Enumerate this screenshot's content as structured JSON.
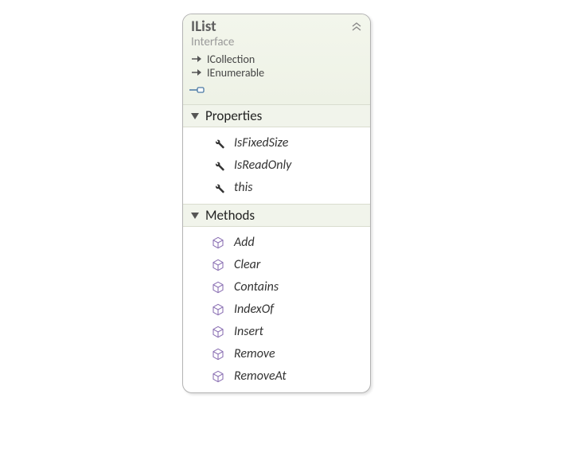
{
  "header": {
    "title": "IList",
    "subtitle": "Interface",
    "inherits": [
      "ICollection",
      "IEnumerable"
    ]
  },
  "sections": {
    "properties": {
      "label": "Properties",
      "members": [
        "IsFixedSize",
        "IsReadOnly",
        "this"
      ]
    },
    "methods": {
      "label": "Methods",
      "members": [
        "Add",
        "Clear",
        "Contains",
        "IndexOf",
        "Insert",
        "Remove",
        "RemoveAt"
      ]
    }
  }
}
